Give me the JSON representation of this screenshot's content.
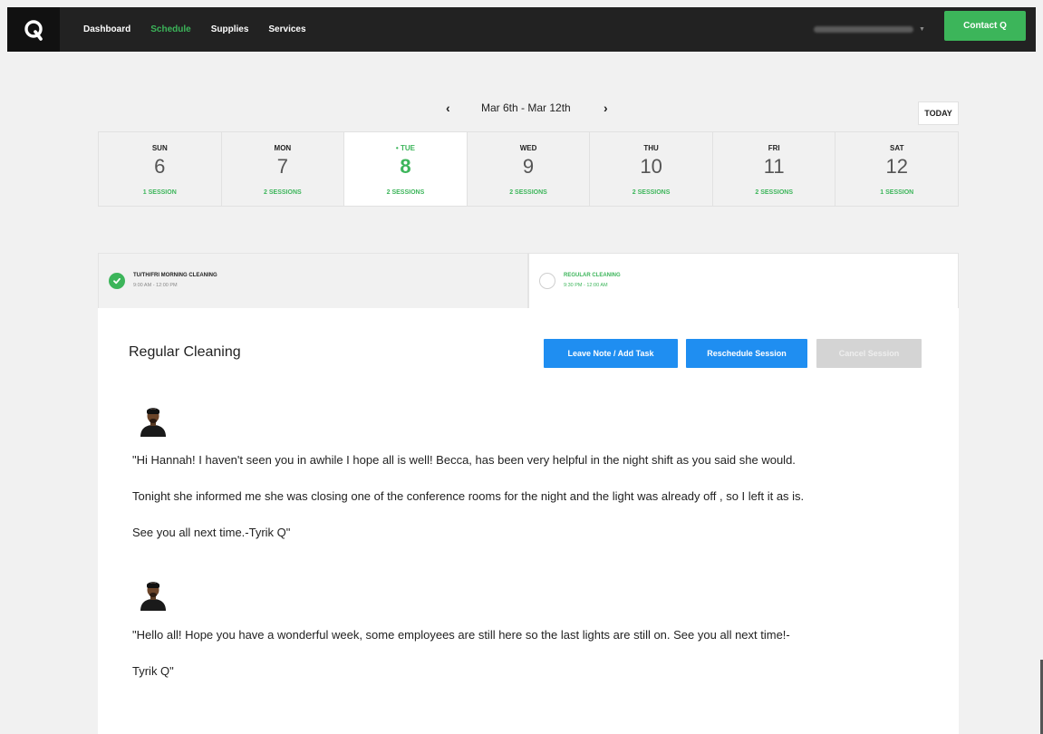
{
  "nav": {
    "items": [
      "Dashboard",
      "Schedule",
      "Supplies",
      "Services"
    ],
    "active": "Schedule",
    "contact_label": "Contact Q"
  },
  "week": {
    "range": "Mar 6th - Mar 12th",
    "today_label": "TODAY",
    "days": [
      {
        "name": "SUN",
        "num": "6",
        "sessions": "1 SESSION"
      },
      {
        "name": "MON",
        "num": "7",
        "sessions": "2 SESSIONS"
      },
      {
        "name": "• TUE",
        "num": "8",
        "sessions": "2 SESSIONS"
      },
      {
        "name": "WED",
        "num": "9",
        "sessions": "2 SESSIONS"
      },
      {
        "name": "THU",
        "num": "10",
        "sessions": "2 SESSIONS"
      },
      {
        "name": "FRI",
        "num": "11",
        "sessions": "2 SESSIONS"
      },
      {
        "name": "SAT",
        "num": "12",
        "sessions": "1 SESSION"
      }
    ]
  },
  "sessions": [
    {
      "title": "TU/TH/FRI MORNING CLEANING",
      "time": "9:00 AM - 12:00 PM",
      "status": "completed"
    },
    {
      "title": "REGULAR CLEANING",
      "time": "9:30 PM - 12:00 AM",
      "status": "selected"
    }
  ],
  "detail": {
    "title": "Regular Cleaning",
    "buttons": {
      "note": "Leave Note / Add Task",
      "reschedule": "Reschedule Session",
      "cancel": "Cancel Session"
    },
    "notes": [
      {
        "lines": [
          "\"Hi Hannah! I haven't seen you in awhile I hope all is well! Becca, has been very helpful in the night shift as you said she would.",
          "Tonight she informed me she was closing one of the conference rooms for the night and the light was already off , so I left it as is.",
          "See you all next time.-Tyrik Q\""
        ]
      },
      {
        "lines": [
          "\"Hello all! Hope you have a wonderful week, some employees are still here so the last lights are still on. See you all next time!-",
          "Tyrik Q\""
        ]
      }
    ]
  },
  "colors": {
    "accent_green": "#3cb55a",
    "button_blue": "#1f8ef1",
    "nav_bg": "#222222"
  }
}
